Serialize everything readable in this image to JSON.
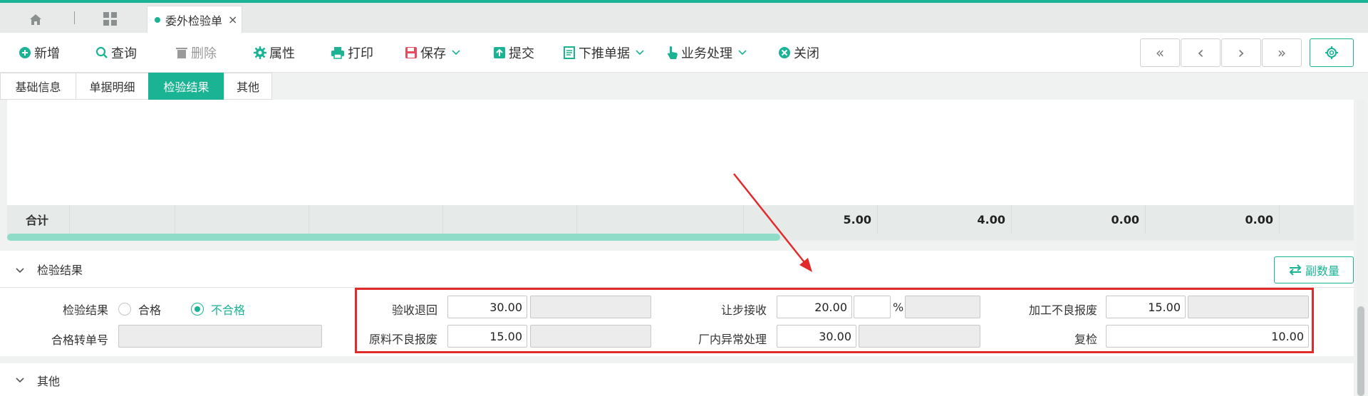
{
  "tab_bar": {
    "doc_tab": {
      "label": "委外检验单",
      "close": "×"
    }
  },
  "toolbar": {
    "new": "新增",
    "query": "查询",
    "delete": "删除",
    "properties": "属性",
    "print": "打印",
    "save": "保存",
    "submit": "提交",
    "push_down": "下推单据",
    "business": "业务处理",
    "close": "关闭",
    "nav": {
      "first": "«",
      "prev": "‹",
      "next": "›",
      "last": "»"
    }
  },
  "sub_tabs": [
    "基础信息",
    "单据明细",
    "检验结果",
    "其他"
  ],
  "active_sub_tab": "检验结果",
  "grid": {
    "summary_label": "合计",
    "totals": [
      "5.00",
      "4.00",
      "0.00",
      "0.00"
    ]
  },
  "section_result": {
    "title": "检验结果",
    "fusl_button": "副数量",
    "result_label": "检验结果",
    "option_pass": "合格",
    "option_fail": "不合格",
    "selected": "不合格",
    "transfer_no_label": "合格转单号",
    "transfer_no_value": "",
    "fields": {
      "return_label": "验收退回",
      "return_value": "30.00",
      "concession_label": "让步接收",
      "concession_value": "20.00",
      "concession_pct": "",
      "pct_sign": "%",
      "process_scrap_label": "加工不良报废",
      "process_scrap_value": "15.00",
      "material_scrap_label": "原料不良报废",
      "material_scrap_value": "15.00",
      "factory_abnormal_label": "厂内异常处理",
      "factory_abnormal_value": "30.00",
      "reinspect_label": "复检",
      "reinspect_value": "10.00"
    }
  },
  "section_other": {
    "title": "其他"
  },
  "colors": {
    "accent": "#1ab394",
    "highlight": "#e12b2b"
  }
}
